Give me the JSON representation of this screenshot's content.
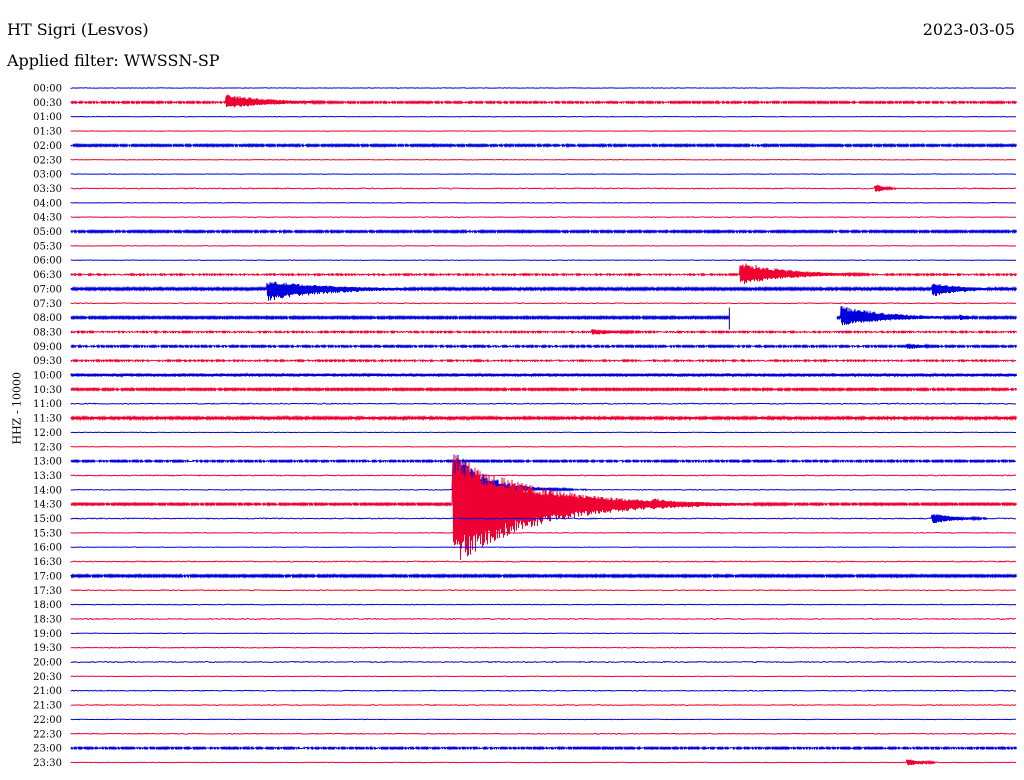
{
  "header": {
    "station": "HT Sigri (Lesvos)",
    "date": "2023-03-05",
    "filter": "Applied filter: WWSSN-SP"
  },
  "axis": {
    "ylabel": "HHZ - 10000"
  },
  "colors": {
    "even_hour_trace": "#0000dd",
    "half_hour_trace": "#ee0033"
  },
  "chart_data": {
    "type": "line",
    "title": "",
    "xlabel": "",
    "ylabel": "HHZ - 10000",
    "row_labels": [
      "00:00",
      "00:30",
      "01:00",
      "01:30",
      "02:00",
      "02:30",
      "03:00",
      "03:30",
      "04:00",
      "04:30",
      "05:00",
      "05:30",
      "06:00",
      "06:30",
      "07:00",
      "07:30",
      "08:00",
      "08:30",
      "09:00",
      "09:30",
      "10:00",
      "10:30",
      "11:00",
      "11:30",
      "12:00",
      "12:30",
      "13:00",
      "13:30",
      "14:00",
      "14:30",
      "15:00",
      "15:30",
      "16:00",
      "16:30",
      "17:00",
      "17:30",
      "18:00",
      "18:30",
      "19:00",
      "19:30",
      "20:00",
      "20:30",
      "21:00",
      "21:30",
      "22:00",
      "22:30",
      "23:00",
      "23:30"
    ],
    "row_minutes": 30,
    "row_noise": [
      0.3,
      0.8,
      0.3,
      0.3,
      0.9,
      0.3,
      0.3,
      0.6,
      0.3,
      0.4,
      0.9,
      0.3,
      0.3,
      0.7,
      1.1,
      0.5,
      1.0,
      0.7,
      0.8,
      0.7,
      1.6,
      0.9,
      0.6,
      1.2,
      0.3,
      0.3,
      0.8,
      0.6,
      0.4,
      0.9,
      0.6,
      0.4,
      0.3,
      0.6,
      1.0,
      0.5,
      0.4,
      0.6,
      0.3,
      0.4,
      0.6,
      0.3,
      0.5,
      0.5,
      0.3,
      0.5,
      0.8,
      0.3
    ],
    "events": [
      {
        "row": 1,
        "minute": 5.0,
        "up": 8,
        "down": 6,
        "decay_min": 1.5
      },
      {
        "row": 7,
        "minute": 25.6,
        "up": 4,
        "down": 4,
        "decay_min": 0.3
      },
      {
        "row": 13,
        "minute": 21.3,
        "up": 13,
        "down": 10,
        "decay_min": 1.5
      },
      {
        "row": 14,
        "minute": 6.3,
        "up": 8,
        "down": 12,
        "decay_min": 2.0
      },
      {
        "row": 14,
        "minute": 27.4,
        "up": 6,
        "down": 8,
        "decay_min": 1.0
      },
      {
        "row": 16,
        "minute": 24.5,
        "up": 12,
        "down": 8,
        "decay_min": 1.5
      },
      {
        "row": 16,
        "minute": 28.3,
        "up": 3,
        "down": 3,
        "decay_min": 0.4
      },
      {
        "row": 16,
        "minute": 32.3,
        "up": 4,
        "down": 4,
        "decay_min": 0.6
      },
      {
        "row": 16,
        "minute": 47.8,
        "up": 48,
        "down": 45,
        "decay_min": 1.8
      },
      {
        "row": 17,
        "minute": 16.6,
        "up": 3,
        "down": 3,
        "decay_min": 1.0
      },
      {
        "row": 17,
        "minute": 53.5,
        "up": 10,
        "down": 12,
        "decay_min": 1.5
      },
      {
        "row": 18,
        "minute": 26.6,
        "up": 3,
        "down": 3,
        "decay_min": 0.6
      },
      {
        "row": 28,
        "minute": 12.2,
        "up": 40,
        "down": 10,
        "decay_min": 1.0
      },
      {
        "row": 29,
        "minute": 12.2,
        "up": 50,
        "down": 62,
        "decay_min": 2.5
      },
      {
        "row": 29,
        "minute": 18.5,
        "up": 6,
        "down": 6,
        "decay_min": 1.2
      },
      {
        "row": 30,
        "minute": 27.4,
        "up": 5,
        "down": 5,
        "decay_min": 0.8
      },
      {
        "row": 30,
        "minute": 46.1,
        "up": 5,
        "down": 5,
        "decay_min": 0.8
      },
      {
        "row": 35,
        "minute": 50.2,
        "up": 8,
        "down": 8,
        "decay_min": 0.3
      },
      {
        "row": 46,
        "minute": 42.5,
        "up": 6,
        "down": 6,
        "decay_min": 0.3
      },
      {
        "row": 46,
        "minute": 52.5,
        "up": 7,
        "down": 10,
        "decay_min": 1.5
      },
      {
        "row": 47,
        "minute": 26.6,
        "up": 3,
        "down": 3,
        "decay_min": 0.6
      }
    ],
    "gaps": [
      {
        "row": 16,
        "start_minute": 20.9,
        "end_minute": 24.3
      }
    ]
  }
}
